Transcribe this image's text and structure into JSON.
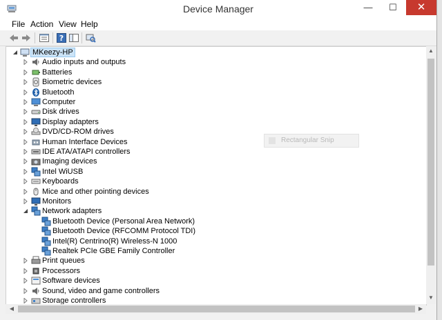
{
  "window": {
    "title": "Device Manager",
    "minimize": "—",
    "maximize": "☐",
    "close": "✕"
  },
  "menu": [
    "File",
    "Action",
    "View",
    "Help"
  ],
  "toolbar": [
    "back",
    "forward",
    "properties-view",
    "help",
    "show-hide",
    "scan"
  ],
  "tree": {
    "root": "MKeezy-HP",
    "categories": [
      {
        "label": "Audio inputs and outputs",
        "icon": "speaker-icon"
      },
      {
        "label": "Batteries",
        "icon": "battery-icon"
      },
      {
        "label": "Biometric devices",
        "icon": "fingerprint-icon"
      },
      {
        "label": "Bluetooth",
        "icon": "bluetooth-icon"
      },
      {
        "label": "Computer",
        "icon": "computer-icon"
      },
      {
        "label": "Disk drives",
        "icon": "disk-icon"
      },
      {
        "label": "Display adapters",
        "icon": "monitor-icon"
      },
      {
        "label": "DVD/CD-ROM drives",
        "icon": "dvd-icon"
      },
      {
        "label": "Human Interface Devices",
        "icon": "hid-icon"
      },
      {
        "label": "IDE ATA/ATAPI controllers",
        "icon": "ide-icon"
      },
      {
        "label": "Imaging devices",
        "icon": "camera-icon"
      },
      {
        "label": "Intel WiUSB",
        "icon": "network-icon"
      },
      {
        "label": "Keyboards",
        "icon": "keyboard-icon"
      },
      {
        "label": "Mice and other pointing devices",
        "icon": "mouse-icon"
      },
      {
        "label": "Monitors",
        "icon": "monitor-icon"
      },
      {
        "label": "Network adapters",
        "icon": "network-icon",
        "expanded": true,
        "children": [
          "Bluetooth Device (Personal Area Network)",
          "Bluetooth Device (RFCOMM Protocol TDI)",
          "Intel(R) Centrino(R) Wireless-N 1000",
          "Realtek PCIe GBE Family Controller"
        ]
      },
      {
        "label": "Print queues",
        "icon": "printer-icon"
      },
      {
        "label": "Processors",
        "icon": "cpu-icon"
      },
      {
        "label": "Software devices",
        "icon": "software-icon"
      },
      {
        "label": "Sound, video and game controllers",
        "icon": "speaker-icon"
      },
      {
        "label": "Storage controllers",
        "icon": "storage-icon"
      }
    ]
  },
  "snip_popup": {
    "label": "Rectangular Snip"
  },
  "colors": {
    "selection": "#cce4f7",
    "close": "#c7392e",
    "network": "#2e75b6"
  }
}
